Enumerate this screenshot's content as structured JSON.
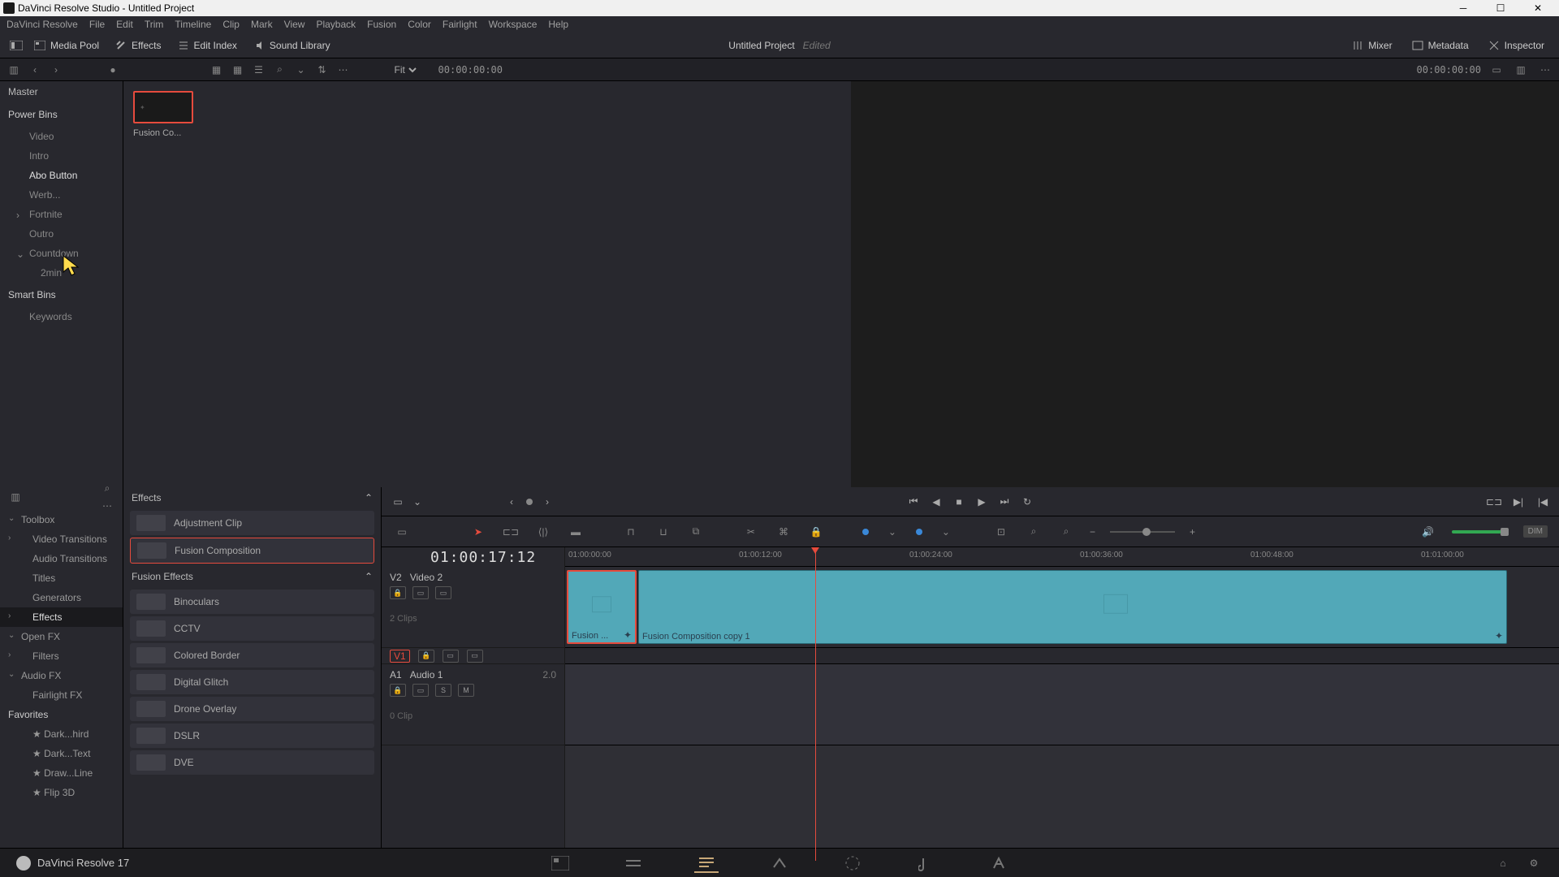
{
  "window": {
    "title": "DaVinci Resolve Studio - Untitled Project"
  },
  "menubar": [
    "DaVinci Resolve",
    "File",
    "Edit",
    "Trim",
    "Timeline",
    "Clip",
    "Mark",
    "View",
    "Playback",
    "Fusion",
    "Color",
    "Fairlight",
    "Workspace",
    "Help"
  ],
  "toolbar": {
    "mediaPool": "Media Pool",
    "effects": "Effects",
    "editIndex": "Edit Index",
    "soundLibrary": "Sound Library",
    "mixer": "Mixer",
    "metadata": "Metadata",
    "inspector": "Inspector"
  },
  "project": {
    "name": "Untitled Project",
    "status": "Edited"
  },
  "viewer": {
    "fit": "Fit",
    "tcLeft": "00:00:00:00",
    "tcRight": "00:00:00:00"
  },
  "bins": {
    "master": "Master",
    "powerBins": "Power Bins",
    "items": [
      "Video",
      "Intro",
      "Abo Button",
      "Werb...",
      "Fortnite",
      "Outro",
      "Countdown",
      "2min"
    ],
    "smartBins": "Smart Bins",
    "keywords": "Keywords"
  },
  "poolClip": {
    "name": "Fusion Co..."
  },
  "fxLeft": {
    "toolbox": "Toolbox",
    "videoTrans": "Video Transitions",
    "audioTrans": "Audio Transitions",
    "titles": "Titles",
    "generators": "Generators",
    "effects": "Effects",
    "openFX": "Open FX",
    "filters": "Filters",
    "audioFX": "Audio FX",
    "fairlightFX": "Fairlight FX",
    "favorites": "Favorites",
    "favs": [
      "Dark...hird",
      "Dark...Text",
      "Draw...Line",
      "Flip 3D"
    ]
  },
  "fxlist": {
    "effects": "Effects",
    "fusionEffects": "Fusion Effects",
    "items": [
      "Adjustment Clip",
      "Fusion Composition",
      "Binoculars",
      "CCTV",
      "Colored Border",
      "Digital Glitch",
      "Drone Overlay",
      "DSLR",
      "DVE"
    ]
  },
  "timeline": {
    "tc": "01:00:17:12",
    "ruler": [
      "01:00:00:00",
      "01:00:12:00",
      "01:00:24:00",
      "01:00:36:00",
      "01:00:48:00",
      "01:01:00:00"
    ],
    "tracks": {
      "v2": {
        "index": "V2",
        "name": "Video 2",
        "clips": "2 Clips"
      },
      "v1": {
        "index": "V1"
      },
      "a1": {
        "index": "A1",
        "name": "Audio 1",
        "meter": "2.0",
        "clips": "0 Clip",
        "s": "S",
        "m": "M"
      }
    },
    "clips": {
      "c1": "Fusion ...",
      "c2": "Fusion Composition copy 1"
    },
    "dim": "DIM"
  },
  "bottom": {
    "app": "DaVinci Resolve 17"
  }
}
